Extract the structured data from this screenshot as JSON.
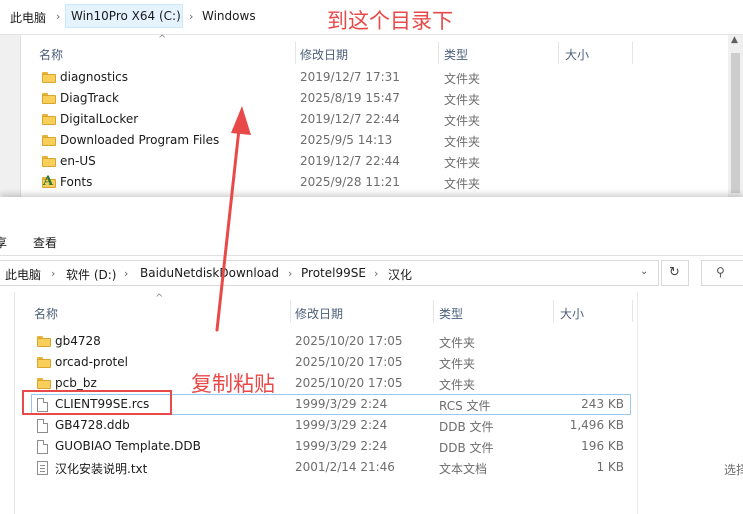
{
  "top_window": {
    "breadcrumb": [
      "此电脑",
      "Win10Pro X64 (C:)",
      "Windows"
    ],
    "columns": [
      "名称",
      "修改日期",
      "类型",
      "大小"
    ],
    "rows": [
      {
        "name": "diagnostics",
        "date": "2019/12/7 17:31",
        "type": "文件夹",
        "icon": "folder-icon"
      },
      {
        "name": "DiagTrack",
        "date": "2025/8/19 15:47",
        "type": "文件夹",
        "icon": "folder-icon"
      },
      {
        "name": "DigitalLocker",
        "date": "2019/12/7 22:44",
        "type": "文件夹",
        "icon": "folder-icon"
      },
      {
        "name": "Downloaded Program Files",
        "date": "2025/9/5 14:13",
        "type": "文件夹",
        "icon": "folder-icon"
      },
      {
        "name": "en-US",
        "date": "2019/12/7 22:44",
        "type": "文件夹",
        "icon": "folder-icon"
      },
      {
        "name": "Fonts",
        "date": "2025/9/28 11:21",
        "type": "文件夹",
        "icon": "fonts-folder-icon"
      }
    ]
  },
  "bottom_window": {
    "ribbon_tabs": [
      "享",
      "查看"
    ],
    "breadcrumb": [
      "此电脑",
      "软件 (D:)",
      "BaiduNetdiskDownload",
      "Protel99SE",
      "汉化"
    ],
    "columns": [
      "名称",
      "修改日期",
      "类型",
      "大小"
    ],
    "rows": [
      {
        "name": "gb4728",
        "date": "2025/10/20 17:05",
        "type": "文件夹",
        "size": "",
        "icon": "folder-icon"
      },
      {
        "name": "orcad-protel",
        "date": "2025/10/20 17:05",
        "type": "文件夹",
        "size": "",
        "icon": "folder-icon"
      },
      {
        "name": "pcb_bz",
        "date": "2025/10/20 17:05",
        "type": "文件夹",
        "size": "",
        "icon": "folder-icon"
      },
      {
        "name": "CLIENT99SE.rcs",
        "date": "1999/3/29 2:24",
        "type": "RCS 文件",
        "size": "243 KB",
        "icon": "file-icon"
      },
      {
        "name": "GB4728.ddb",
        "date": "1999/3/29 2:24",
        "type": "DDB 文件",
        "size": "1,496 KB",
        "icon": "file-icon"
      },
      {
        "name": "GUOBIAO Template.DDB",
        "date": "1999/3/29 2:24",
        "type": "DDB 文件",
        "size": "196 KB",
        "icon": "file-icon"
      },
      {
        "name": "汉化安装说明.txt",
        "date": "2001/2/14 21:46",
        "type": "文本文档",
        "size": "1 KB",
        "icon": "text-file-icon"
      }
    ],
    "side_text": "选择"
  },
  "annotations": {
    "top_note": "到这个目录下",
    "copy_note": "复制粘贴",
    "color": "#e84a4a"
  }
}
